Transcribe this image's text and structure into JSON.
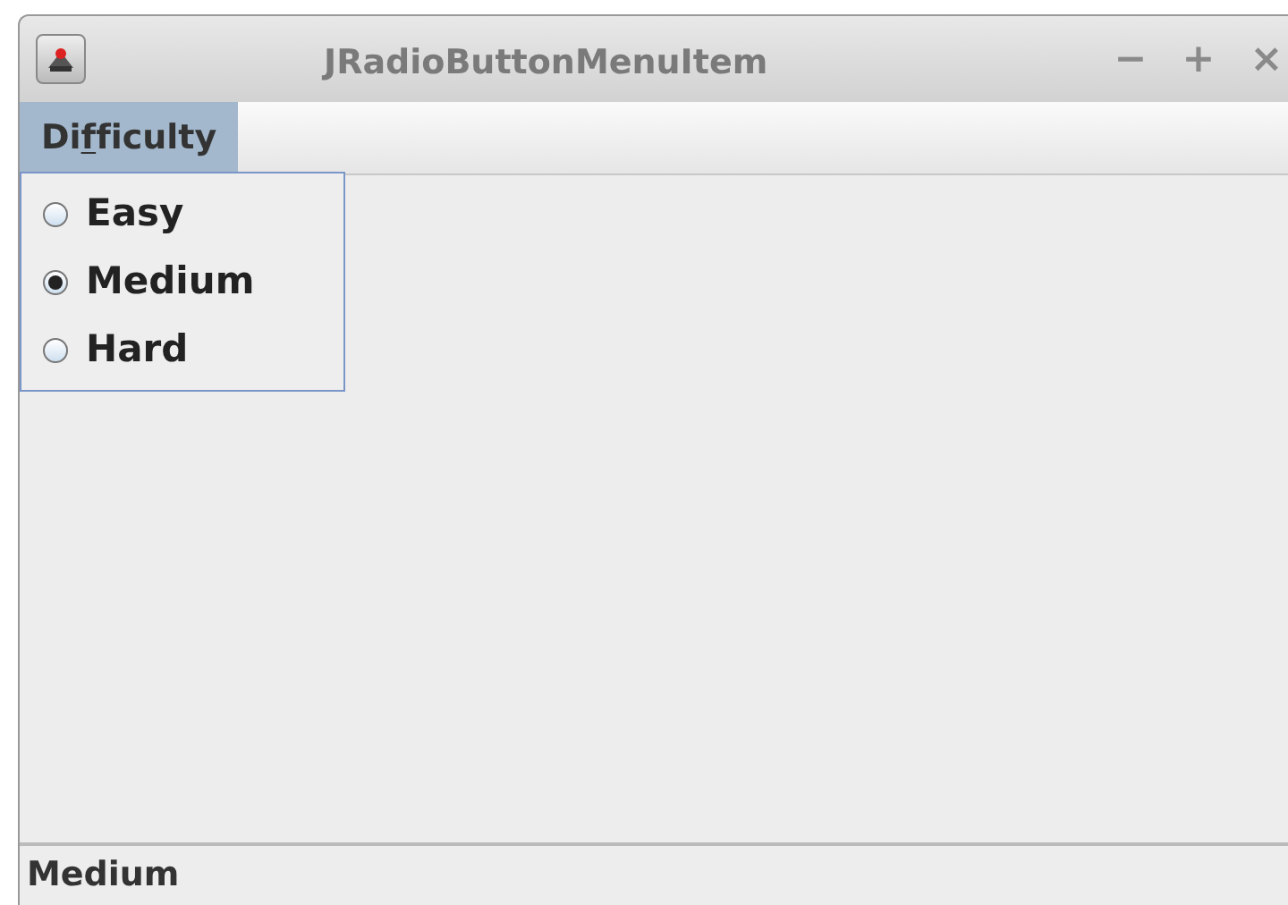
{
  "window": {
    "title": "JRadioButtonMenuItem",
    "controls": [
      "−",
      "+",
      "×"
    ]
  },
  "menu_bar": [
    {
      "label_start": "Di",
      "mnemonic": "f",
      "label_end": "ficulty",
      "selected": true
    }
  ],
  "popup_menu": [
    {
      "label": "Easy",
      "selected": false
    },
    {
      "label": "Medium",
      "selected": true
    },
    {
      "label": "Hard",
      "selected": false
    }
  ],
  "status_bar": "Medium"
}
